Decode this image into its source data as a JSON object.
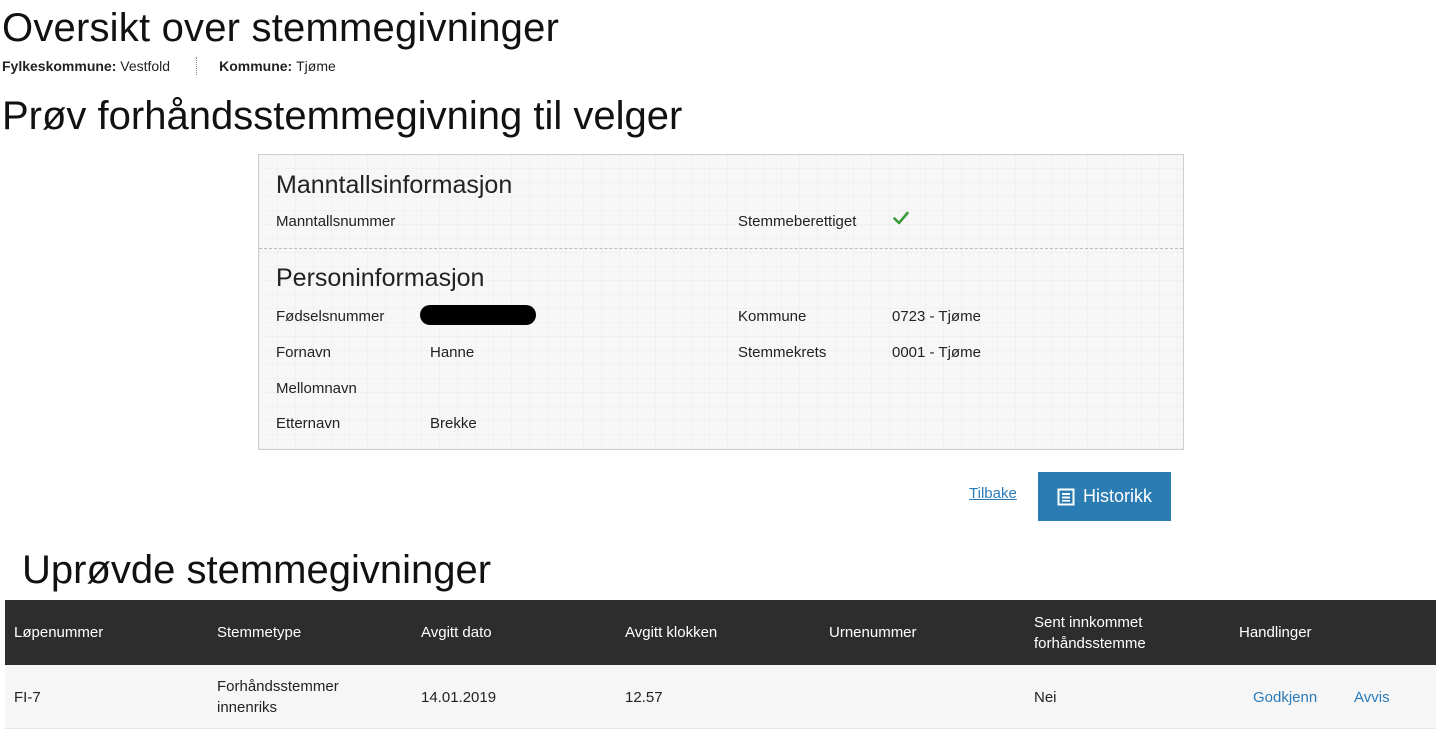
{
  "header": {
    "title": "Oversikt over stemmegivninger",
    "county_label": "Fylkeskommune:",
    "county_value": "Vestfold",
    "municipality_label": "Kommune:",
    "municipality_value": "Tjøme"
  },
  "section": {
    "title": "Prøv forhåndsstemmegivning til velger"
  },
  "registry_info": {
    "heading": "Manntallsinformasjon",
    "registry_number_label": "Manntallsnummer",
    "registry_number_value": "",
    "eligible_label": "Stemmeberettiget",
    "eligible_icon": "check-icon",
    "eligible_color": "#3c9a3c"
  },
  "person_info": {
    "heading": "Personinformasjon",
    "ssn_label": "Fødselsnummer",
    "first_name_label": "Fornavn",
    "first_name_value": "Hanne",
    "middle_name_label": "Mellomnavn",
    "middle_name_value": "",
    "last_name_label": "Etternavn",
    "last_name_value": "Brekke",
    "municipality_label": "Kommune",
    "municipality_value": "0723 - Tjøme",
    "district_label": "Stemmekrets",
    "district_value": "0001 - Tjøme"
  },
  "actions": {
    "back_label": "Tilbake",
    "history_label": "Historikk",
    "history_icon": "list-icon",
    "accent_color": "#2a7cb2"
  },
  "unverified": {
    "title": "Uprøvde stemmegivninger",
    "columns": [
      "Løpenummer",
      "Stemmetype",
      "Avgitt dato",
      "Avgitt klokken",
      "Urnenummer",
      "Sent innkommet forhåndsstemme",
      "Handlinger"
    ],
    "rows": [
      {
        "number": "FI-7",
        "type": "Forhåndsstemmer innenriks",
        "date": "14.01.2019",
        "time": "12.57",
        "urn": "",
        "late": "Nei",
        "approve_label": "Godkjenn",
        "reject_label": "Avvis"
      }
    ]
  }
}
